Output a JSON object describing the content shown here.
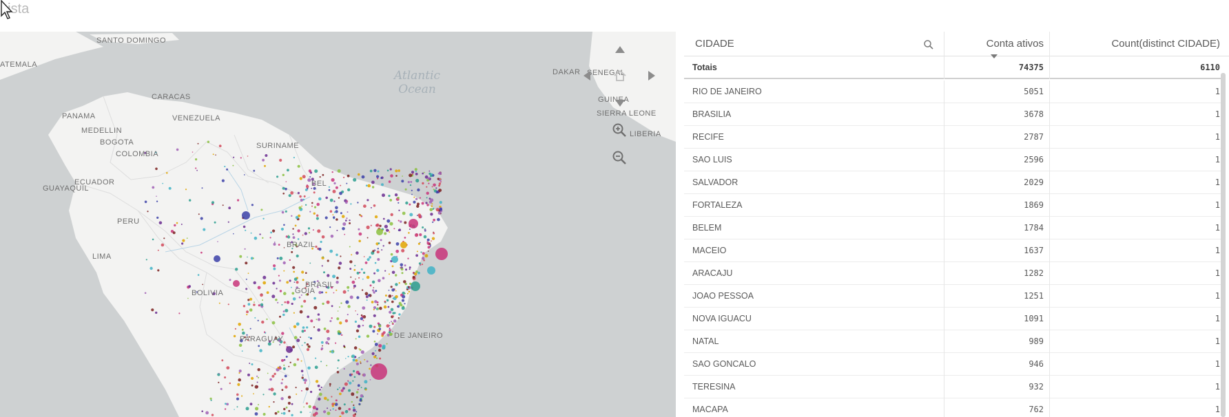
{
  "sheet": {
    "title": "Lista"
  },
  "map": {
    "ocean_label": "Atlantic\nOcean",
    "labels": [
      {
        "id": "santo-domingo",
        "text": "SANTO DOMINGO"
      },
      {
        "id": "atemala",
        "text": "ATEMALA"
      },
      {
        "id": "caracas",
        "text": "CARACAS"
      },
      {
        "id": "panama",
        "text": "PANAMA"
      },
      {
        "id": "venezuela",
        "text": "VENEZUELA"
      },
      {
        "id": "medellin",
        "text": "MEDELLIN"
      },
      {
        "id": "bogota",
        "text": "BOGOTA"
      },
      {
        "id": "colombia",
        "text": "COLOMBIA"
      },
      {
        "id": "suriname",
        "text": "SURINAME"
      },
      {
        "id": "ecuador",
        "text": "ECUADOR"
      },
      {
        "id": "guayaquil",
        "text": "GUAYAQUIL"
      },
      {
        "id": "peru",
        "text": "PERU"
      },
      {
        "id": "brazil",
        "text": "BRAZIL"
      },
      {
        "id": "lima",
        "text": "LIMA"
      },
      {
        "id": "bolivia",
        "text": "BOLIVIA"
      },
      {
        "id": "paraguay",
        "text": "PARAGUAY"
      },
      {
        "id": "rio",
        "text": "DE JANEIRO"
      },
      {
        "id": "dakar",
        "text": "DAKAR"
      },
      {
        "id": "senegal",
        "text": "SENEGAL"
      },
      {
        "id": "guinea",
        "text": "GUINEA"
      },
      {
        "id": "sierra-leone",
        "text": "SIERRA LEONE"
      },
      {
        "id": "liberia",
        "text": "LIBERIA"
      },
      {
        "id": "belem",
        "text": "BEL"
      },
      {
        "id": "brasilia",
        "text": "BRASIL"
      },
      {
        "id": "goias",
        "text": "GOIA"
      }
    ]
  },
  "table": {
    "headers": {
      "city": "CIDADE",
      "ativos": "Conta ativos",
      "count": "Count(distinct CIDADE)"
    },
    "totals": {
      "label": "Totais",
      "ativos": "74375",
      "count": "6110"
    },
    "rows": [
      {
        "city": "RIO DE JANEIRO",
        "ativos": "5051",
        "count": "1"
      },
      {
        "city": "BRASILIA",
        "ativos": "3678",
        "count": "1"
      },
      {
        "city": "RECIFE",
        "ativos": "2787",
        "count": "1"
      },
      {
        "city": "SAO LUIS",
        "ativos": "2596",
        "count": "1"
      },
      {
        "city": "SALVADOR",
        "ativos": "2029",
        "count": "1"
      },
      {
        "city": "FORTALEZA",
        "ativos": "1869",
        "count": "1"
      },
      {
        "city": "BELEM",
        "ativos": "1784",
        "count": "1"
      },
      {
        "city": "MACEIO",
        "ativos": "1637",
        "count": "1"
      },
      {
        "city": "ARACAJU",
        "ativos": "1282",
        "count": "1"
      },
      {
        "city": "JOAO PESSOA",
        "ativos": "1251",
        "count": "1"
      },
      {
        "city": "NOVA IGUACU",
        "ativos": "1091",
        "count": "1"
      },
      {
        "city": "NATAL",
        "ativos": "989",
        "count": "1"
      },
      {
        "city": "SAO GONCALO",
        "ativos": "946",
        "count": "1"
      },
      {
        "city": "TERESINA",
        "ativos": "932",
        "count": "1"
      },
      {
        "city": "MACAPA",
        "ativos": "762",
        "count": "1"
      }
    ]
  },
  "colors": {
    "land": "#f3f3f2",
    "water": "#ced1d2",
    "border": "#d9d9d9",
    "dot_palette": [
      "#6a2c91",
      "#c8347a",
      "#2a9d8f",
      "#8bbf3f",
      "#e0a400",
      "#d1495b",
      "#3b3fa8",
      "#7a1f1f",
      "#41b3c7",
      "#a05fb5"
    ]
  }
}
